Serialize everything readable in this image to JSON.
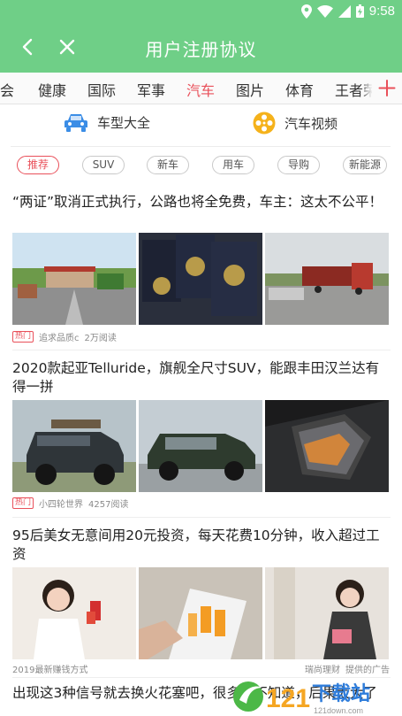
{
  "status_bar": {
    "time": "9:58"
  },
  "header": {
    "title": "用户注册协议"
  },
  "tabs": [
    {
      "label": "社会",
      "active": false
    },
    {
      "label": "健康",
      "active": false
    },
    {
      "label": "国际",
      "active": false
    },
    {
      "label": "军事",
      "active": false
    },
    {
      "label": "汽车",
      "active": true
    },
    {
      "label": "图片",
      "active": false
    },
    {
      "label": "体育",
      "active": false
    },
    {
      "label": "王者荣",
      "active": false
    }
  ],
  "features": [
    {
      "label": "车型大全",
      "icon": "car-icon"
    },
    {
      "label": "汽车视频",
      "icon": "film-reel-icon"
    }
  ],
  "chips": [
    {
      "label": "推荐",
      "active": true
    },
    {
      "label": "SUV",
      "active": false
    },
    {
      "label": "新车",
      "active": false
    },
    {
      "label": "用车",
      "active": false
    },
    {
      "label": "导购",
      "active": false
    },
    {
      "label": "新能源",
      "active": false
    }
  ],
  "articles": [
    {
      "headline": "“两证”取消正式执行，公路也将全免费，车主：这太不公平！",
      "tag": "热门",
      "source": "追求品质c",
      "reads": "2万阅读"
    },
    {
      "headline": "2020款起亚Telluride，旗舰全尺寸SUV，能跟丰田汉兰达有得一拼",
      "tag": "热门",
      "source": "小四轮世界",
      "reads": "4257阅读"
    },
    {
      "headline": "95后美女无意间用20元投资，每天花费10分钟，收入超过工资",
      "source": "2019最新赚钱方式",
      "ad_source": "瑞尚理财",
      "ad_label": "提供的广告"
    },
    {
      "headline": "出现这3种信号就去换火花塞吧，很多人不知道，后果太大了"
    }
  ],
  "watermark": {
    "text": "下载站",
    "number": "121",
    "domain": "121down.com"
  },
  "colors": {
    "brand": "#6fcf87",
    "accent": "#e9505a"
  }
}
